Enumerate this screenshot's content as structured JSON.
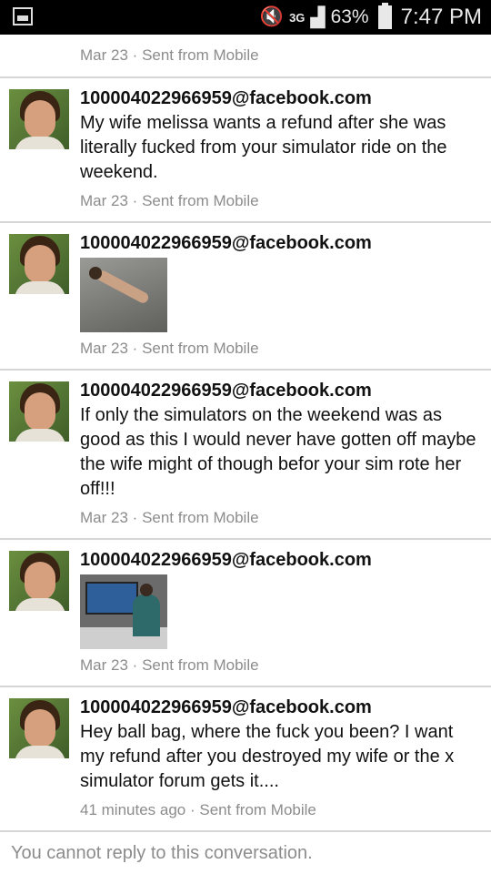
{
  "status_bar": {
    "network": "3G",
    "battery": "63%",
    "time": "7:47 PM"
  },
  "first_meta": {
    "date": "Mar 23",
    "separator": "·",
    "source": "Sent from Mobile"
  },
  "messages": [
    {
      "sender": "100004022966959@facebook.com",
      "text": "My wife melissa wants a refund after she was literally fucked from your simulator ride on the weekend.",
      "date": "Mar 23",
      "separator": "·",
      "source": "Sent from Mobile"
    },
    {
      "sender": "100004022966959@facebook.com",
      "attachment": "photo",
      "date": "Mar 23",
      "separator": "·",
      "source": "Sent from Mobile"
    },
    {
      "sender": "100004022966959@facebook.com",
      "text": "If only the simulators on the weekend was as good as this I would never have gotten off maybe the wife might of though befor your sim rote her off!!!",
      "date": "Mar 23",
      "separator": "·",
      "source": "Sent from Mobile"
    },
    {
      "sender": "100004022966959@facebook.com",
      "attachment": "photo",
      "date": "Mar 23",
      "separator": "·",
      "source": "Sent from Mobile"
    },
    {
      "sender": "100004022966959@facebook.com",
      "text": "Hey ball bag, where the fuck you been? I want my refund after you destroyed my wife or the x simulator forum gets it....",
      "date": "41 minutes ago",
      "separator": "·",
      "source": "Sent from Mobile"
    }
  ],
  "footer": {
    "notice": "You cannot reply to this conversation."
  }
}
